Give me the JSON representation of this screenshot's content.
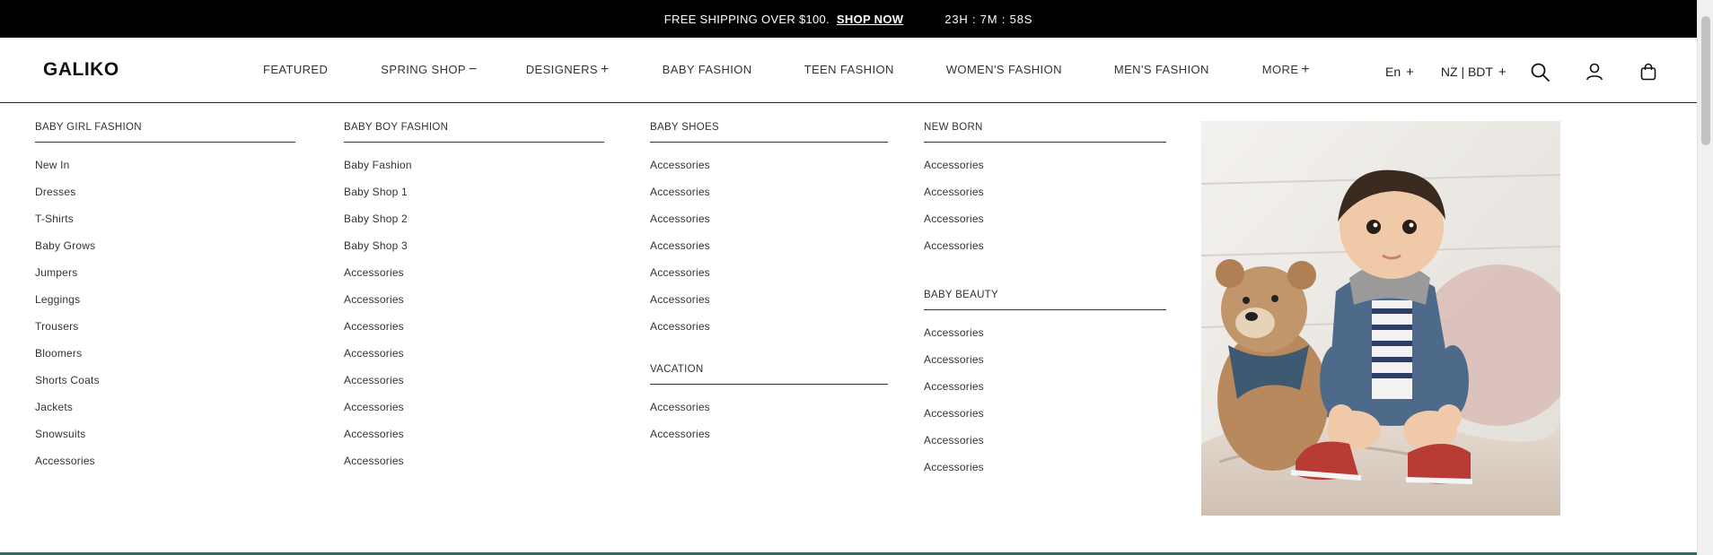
{
  "announcement": {
    "text": "FREE SHIPPING OVER $100.",
    "link": "SHOP NOW",
    "countdown": "23H : 7M : 58S"
  },
  "header": {
    "logo": "GALIKO",
    "nav": [
      {
        "label": "FEATURED",
        "sign": ""
      },
      {
        "label": "SPRING SHOP",
        "sign": "−"
      },
      {
        "label": "DESIGNERS",
        "sign": "+"
      },
      {
        "label": "BABY FASHION",
        "sign": ""
      },
      {
        "label": "TEEN FASHION",
        "sign": ""
      },
      {
        "label": "WOMEN'S FASHION",
        "sign": ""
      },
      {
        "label": "MEN'S FASHION",
        "sign": ""
      },
      {
        "label": "MORE",
        "sign": "+"
      }
    ],
    "language": "En",
    "currency": "NZ | BDT",
    "plus_sign": "+",
    "icons": [
      "search-icon",
      "account-icon",
      "cart-icon"
    ]
  },
  "mega_menu": {
    "baby_girl": {
      "title": "BABY GIRL FASHION",
      "items": [
        "New In",
        "Dresses",
        "T-Shirts",
        "Baby Grows",
        "Jumpers",
        "Leggings",
        "Trousers",
        "Bloomers",
        "Shorts Coats",
        "Jackets",
        "Snowsuits",
        "Accessories"
      ]
    },
    "baby_boy": {
      "title": "BABY BOY FASHION",
      "items": [
        "Baby Fashion",
        "Baby Shop 1",
        "Baby Shop 2",
        "Baby Shop 3",
        "Accessories",
        "Accessories",
        "Accessories",
        "Accessories",
        "Accessories",
        "Accessories",
        "Accessories",
        "Accessories"
      ]
    },
    "baby_shoes": {
      "title": "BABY SHOES",
      "items": [
        "Accessories",
        "Accessories",
        "Accessories",
        "Accessories",
        "Accessories",
        "Accessories",
        "Accessories"
      ]
    },
    "vacation": {
      "title": "VACATION",
      "items": [
        "Accessories",
        "Accessories"
      ]
    },
    "new_born": {
      "title": "NEW BORN",
      "items": [
        "Accessories",
        "Accessories",
        "Accessories",
        "Accessories"
      ]
    },
    "baby_beauty": {
      "title": "BABY BEAUTY",
      "items": [
        "Accessories",
        "Accessories",
        "Accessories",
        "Accessories",
        "Accessories",
        "Accessories"
      ]
    }
  },
  "colors": {
    "topbar_bg": "#000000",
    "text": "#333333",
    "strip": "#3b6660"
  }
}
